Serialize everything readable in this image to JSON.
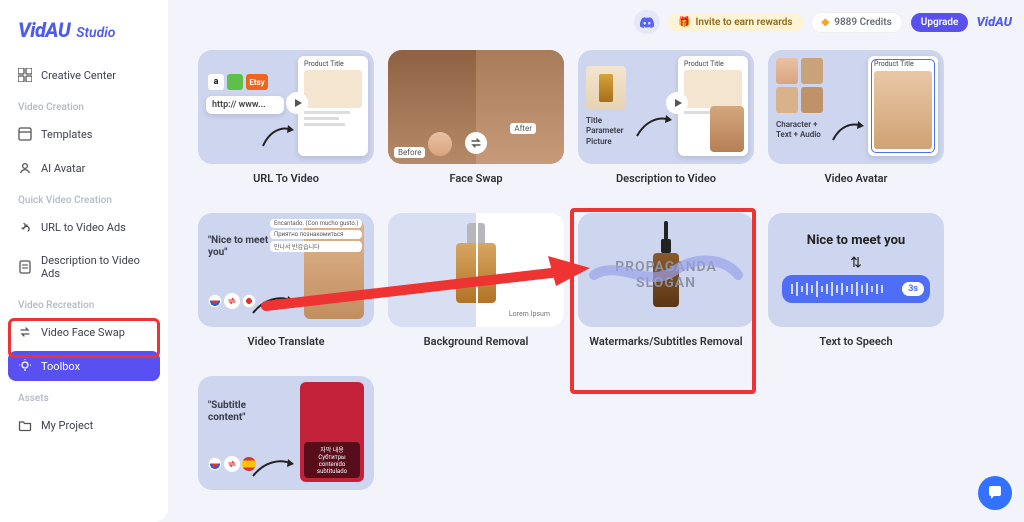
{
  "brand": {
    "name": "VidAU",
    "studio": "Studio"
  },
  "topbar": {
    "invite": "Invite to earn rewards",
    "credits": "9889 Credits",
    "upgrade": "Upgrade"
  },
  "sidebar": {
    "creative_center": "Creative Center",
    "section_video_creation": "Video Creation",
    "templates": "Templates",
    "ai_avatar": "AI Avatar",
    "section_quick": "Quick Video Creation",
    "url_to_video_ads": "URL to Video Ads",
    "description_to_video_ads": "Description to Video Ads",
    "section_recreation": "Video Recreation",
    "video_face_swap": "Video Face Swap",
    "toolbox": "Toolbox",
    "section_assets": "Assets",
    "my_project": "My Project"
  },
  "cards": {
    "url_to_video": {
      "title": "URL To Video",
      "panel": "Product Title",
      "urlbar": "http:// www...",
      "icons": [
        "a",
        "shopify",
        "etsy"
      ]
    },
    "face_swap": {
      "title": "Face Swap",
      "before": "Before",
      "after": "After"
    },
    "desc_to_video": {
      "title": "Description to Video",
      "panel": "Product Title",
      "left_lines": [
        "Title",
        "Parameter",
        "Picture"
      ]
    },
    "video_avatar": {
      "title": "Video Avatar",
      "panel": "Product Title",
      "left_lines": [
        "Character +",
        "Text + Audio"
      ]
    },
    "video_translate": {
      "title": "Video Translate",
      "snippet": "\"Nice to meet you\"",
      "bubbles": [
        "Encantado. (Con mucho gusto.)",
        "Приятно познакомиться",
        "만나서 반갑습니다"
      ]
    },
    "bg_removal": {
      "title": "Background Removal",
      "brand_label": "Lorem Ipsum"
    },
    "wm_removal": {
      "title": "Watermarks/Subtitles Removal",
      "overlay1": "PROPAGANDA",
      "overlay2": "SLOGAN"
    },
    "tts": {
      "title": "Text to Speech",
      "phrase": "Nice to meet you",
      "duration": "3s"
    },
    "subtitle_content": {
      "snippet": "\"Subtitle content\"",
      "lines": [
        "자막 내용",
        "Субтитры",
        "contenido subtitulado"
      ]
    }
  }
}
